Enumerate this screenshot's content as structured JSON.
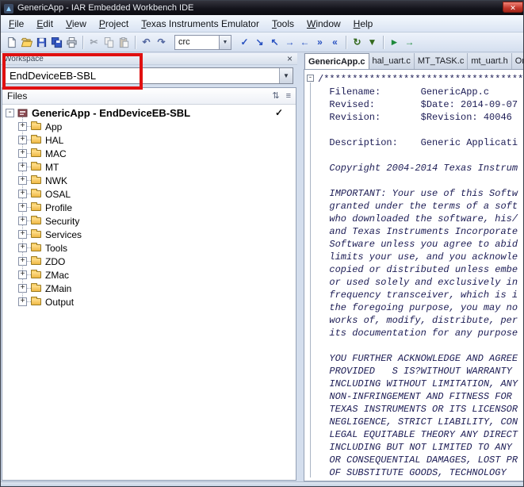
{
  "window": {
    "title": "GenericApp - IAR Embedded Workbench IDE",
    "close_glyph": "✕"
  },
  "menu": {
    "items": [
      "File",
      "Edit",
      "View",
      "Project",
      "Texas Instruments Emulator",
      "Tools",
      "Window",
      "Help"
    ]
  },
  "toolbar": {
    "search_value": "crc",
    "dropdown_glyph": "▼",
    "left_groups": [
      [
        "new-document",
        "open-folder",
        "save",
        "save-all",
        "print"
      ],
      [
        "cut",
        "copy",
        "paste"
      ],
      [
        "undo",
        "redo"
      ]
    ],
    "right_groups": [
      [
        {
          "name": "goto-check-icon",
          "glyph": "✓",
          "color": "#2750c0"
        },
        {
          "name": "navigate-forward-icon",
          "glyph": "↘",
          "color": "#2750c0"
        },
        {
          "name": "navigate-backward-icon",
          "glyph": "↖",
          "color": "#2750c0"
        },
        {
          "name": "find-next-icon",
          "glyph": "→",
          "color": "#2750c0"
        },
        {
          "name": "find-previous-icon",
          "glyph": "←",
          "color": "#2750c0"
        },
        {
          "name": "next-bookmark-icon",
          "glyph": "»",
          "color": "#2750c0"
        },
        {
          "name": "previous-bookmark-icon",
          "glyph": "«",
          "color": "#2750c0"
        }
      ],
      [
        {
          "name": "compile-icon",
          "glyph": "↻",
          "color": "#33691e"
        },
        {
          "name": "make-icon",
          "glyph": "▼",
          "color": "#33691e"
        }
      ],
      [
        {
          "name": "download-debug-icon",
          "glyph": "►",
          "color": "#1e8a3c"
        },
        {
          "name": "debug-without-download-icon",
          "glyph": "→",
          "color": "#1e8a3c"
        }
      ]
    ]
  },
  "workspace": {
    "title": "Workspace",
    "close_glyph": "×",
    "config_value": "EndDeviceEB-SBL",
    "arrow_glyph": "▼",
    "files_header": "Files",
    "header_icons": [
      {
        "name": "sort-order-icon",
        "glyph": "⇅"
      },
      {
        "name": "columns-icon",
        "glyph": "≡"
      }
    ],
    "project": {
      "label": "GenericApp - EndDeviceEB-SBL",
      "check": "✓"
    },
    "folders": [
      "App",
      "HAL",
      "MAC",
      "MT",
      "NWK",
      "OSAL",
      "Profile",
      "Security",
      "Services",
      "Tools",
      "ZDO",
      "ZMac",
      "ZMain",
      "Output"
    ]
  },
  "editor": {
    "tabs": [
      {
        "label": "GenericApp.c",
        "active": true
      },
      {
        "label": "hal_uart.c",
        "active": false
      },
      {
        "label": "MT_TASK.c",
        "active": false
      },
      {
        "label": "mt_uart.h",
        "active": false
      },
      {
        "label": "On",
        "active": false
      }
    ],
    "fold_marker": "-",
    "code_lines": [
      {
        "text": "/************************************",
        "italic": false
      },
      {
        "text": "  Filename:       GenericApp.c",
        "italic": false
      },
      {
        "text": "  Revised:        $Date: 2014-09-07",
        "italic": false
      },
      {
        "text": "  Revision:       $Revision: 40046",
        "italic": false
      },
      {
        "text": "",
        "italic": false
      },
      {
        "text": "  Description:    Generic Applicati",
        "italic": false
      },
      {
        "text": "",
        "italic": false
      },
      {
        "text": "  Copyright 2004-2014 Texas Instrum",
        "italic": true
      },
      {
        "text": "",
        "italic": true
      },
      {
        "text": "  IMPORTANT: Your use of this Softw",
        "italic": true
      },
      {
        "text": "  granted under the terms of a soft",
        "italic": true
      },
      {
        "text": "  who downloaded the software, his/",
        "italic": true
      },
      {
        "text": "  and Texas Instruments Incorporate",
        "italic": true
      },
      {
        "text": "  Software unless you agree to abid",
        "italic": true
      },
      {
        "text": "  limits your use, and you acknowle",
        "italic": true
      },
      {
        "text": "  copied or distributed unless embe",
        "italic": true
      },
      {
        "text": "  or used solely and exclusively in",
        "italic": true
      },
      {
        "text": "  frequency transceiver, which is i",
        "italic": true
      },
      {
        "text": "  the foregoing purpose, you may no",
        "italic": true
      },
      {
        "text": "  works of, modify, distribute, per",
        "italic": true
      },
      {
        "text": "  its documentation for any purpose",
        "italic": true
      },
      {
        "text": "",
        "italic": true
      },
      {
        "text": "  YOU FURTHER ACKNOWLEDGE AND AGREE",
        "italic": true
      },
      {
        "text": "  PROVIDED   S IS?WITHOUT WARRANTY ",
        "italic": true
      },
      {
        "text": "  INCLUDING WITHOUT LIMITATION, ANY",
        "italic": true
      },
      {
        "text": "  NON-INFRINGEMENT AND FITNESS FOR ",
        "italic": true
      },
      {
        "text": "  TEXAS INSTRUMENTS OR ITS LICENSOR",
        "italic": true
      },
      {
        "text": "  NEGLIGENCE, STRICT LIABILITY, CON",
        "italic": true
      },
      {
        "text": "  LEGAL EQUITABLE THEORY ANY DIRECT",
        "italic": true
      },
      {
        "text": "  INCLUDING BUT NOT LIMITED TO ANY ",
        "italic": true
      },
      {
        "text": "  OR CONSEQUENTIAL DAMAGES, LOST PR",
        "italic": true
      },
      {
        "text": "  OF SUBSTITUTE GOODS, TECHNOLOGY",
        "italic": true
      }
    ]
  },
  "annotation": {
    "color": "#e01010"
  }
}
